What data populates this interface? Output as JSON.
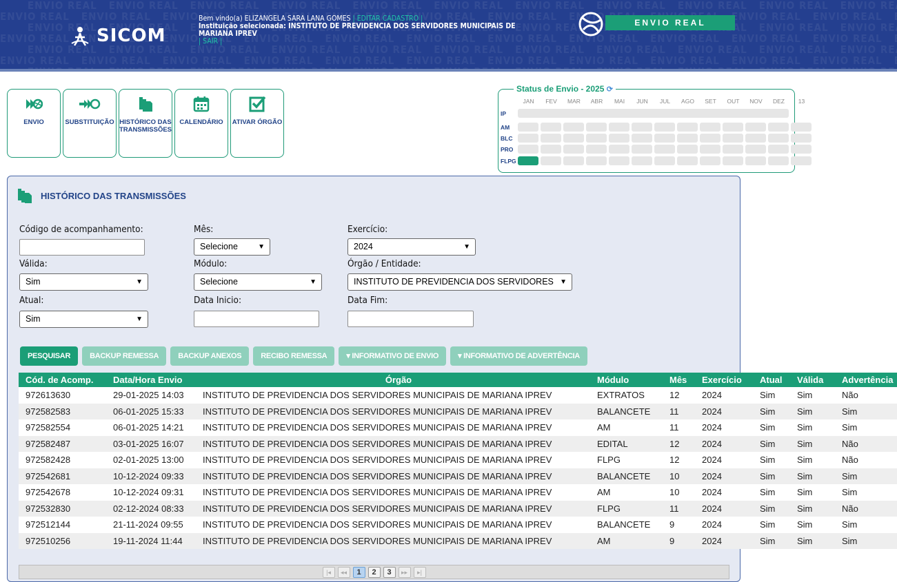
{
  "header": {
    "logo_text": "SICOM",
    "welcome_prefix": "Bem vindo(a) ",
    "user_name": "ELIZANGELA SARA LANA GOMES",
    "edit_link": " | EDITAR CADASTRO | ",
    "institution_label": "Instituição selecionada: ",
    "institution_name": "INSTITUTO DE PREVIDENCIA DOS SERVIDORES MUNICIPAIS DE MARIANA IPREV",
    "logout_link": "| SAIR |",
    "mode_badge": "ENVIO REAL",
    "watermark_word": "ENVIO REAL"
  },
  "toolbar": [
    {
      "label": "ENVIO",
      "icon": "envio-icon"
    },
    {
      "label": "SUBSTITUIÇÃO",
      "icon": "substituicao-icon"
    },
    {
      "label": "HISTÓRICO DAS TRANSMISSÕES",
      "icon": "historico-icon"
    },
    {
      "label": "CALENDÁRIO",
      "icon": "calendar-icon"
    },
    {
      "label": "ATIVAR ÓRGÃO",
      "icon": "checkbox-icon"
    }
  ],
  "status_envio": {
    "title": "Status de Envio - 2025",
    "months": [
      "JAN",
      "FEV",
      "MAR",
      "ABR",
      "MAI",
      "JUN",
      "JUL",
      "AGO",
      "SET",
      "OUT",
      "NOV",
      "DEZ",
      "13"
    ],
    "rows": [
      "IP",
      "AM",
      "BLC",
      "PRO",
      "FLPG"
    ],
    "sent": {
      "FLPG": [
        "JAN"
      ]
    }
  },
  "panel": {
    "title": "HISTÓRICO DAS TRANSMISSÕES",
    "filters": {
      "codigo_label": "Código de acompanhamento:",
      "codigo_value": "",
      "mes_label": "Mês:",
      "mes_value": "Selecione",
      "exercicio_label": "Exercício:",
      "exercicio_value": "2024",
      "valida_label": "Válida:",
      "valida_value": "Sim",
      "modulo_label": "Módulo:",
      "modulo_value": "Selecione",
      "orgao_label": "Órgão / Entidade:",
      "orgao_value": "INSTITUTO DE PREVIDENCIA DOS SERVIDORES",
      "atual_label": "Atual:",
      "atual_value": "Sim",
      "data_inicio_label": "Data Inicio:",
      "data_inicio_value": "",
      "data_fim_label": "Data Fim:",
      "data_fim_value": ""
    },
    "actions": {
      "pesquisar": "PESQUISAR",
      "backup_remessa": "BACKUP REMESSA",
      "backup_anexos": "BACKUP ANEXOS",
      "recibo_remessa": "RECIBO REMESSA",
      "informativo_envio": "INFORMATIVO DE ENVIO",
      "informativo_advertencia": "INFORMATIVO DE ADVERTÊNCIA"
    }
  },
  "table": {
    "columns": [
      "Cód. de Acomp.",
      "Data/Hora Envio",
      "Órgão",
      "Módulo",
      "Mês",
      "Exercício",
      "Atual",
      "Válida",
      "Advertência"
    ],
    "rows": [
      [
        "972613630",
        "29-01-2025 14:03",
        "INSTITUTO DE PREVIDENCIA DOS SERVIDORES MUNICIPAIS DE MARIANA IPREV",
        "EXTRATOS",
        "12",
        "2024",
        "Sim",
        "Sim",
        "Não"
      ],
      [
        "972582583",
        "06-01-2025 15:33",
        "INSTITUTO DE PREVIDENCIA DOS SERVIDORES MUNICIPAIS DE MARIANA IPREV",
        "BALANCETE",
        "11",
        "2024",
        "Sim",
        "Sim",
        "Sim"
      ],
      [
        "972582554",
        "06-01-2025 14:21",
        "INSTITUTO DE PREVIDENCIA DOS SERVIDORES MUNICIPAIS DE MARIANA IPREV",
        "AM",
        "11",
        "2024",
        "Sim",
        "Sim",
        "Sim"
      ],
      [
        "972582487",
        "03-01-2025 16:07",
        "INSTITUTO DE PREVIDENCIA DOS SERVIDORES MUNICIPAIS DE MARIANA IPREV",
        "EDITAL",
        "12",
        "2024",
        "Sim",
        "Sim",
        "Não"
      ],
      [
        "972582428",
        "02-01-2025 13:00",
        "INSTITUTO DE PREVIDENCIA DOS SERVIDORES MUNICIPAIS DE MARIANA IPREV",
        "FLPG",
        "12",
        "2024",
        "Sim",
        "Sim",
        "Não"
      ],
      [
        "972542681",
        "10-12-2024 09:33",
        "INSTITUTO DE PREVIDENCIA DOS SERVIDORES MUNICIPAIS DE MARIANA IPREV",
        "BALANCETE",
        "10",
        "2024",
        "Sim",
        "Sim",
        "Sim"
      ],
      [
        "972542678",
        "10-12-2024 09:31",
        "INSTITUTO DE PREVIDENCIA DOS SERVIDORES MUNICIPAIS DE MARIANA IPREV",
        "AM",
        "10",
        "2024",
        "Sim",
        "Sim",
        "Sim"
      ],
      [
        "972532830",
        "02-12-2024 08:33",
        "INSTITUTO DE PREVIDENCIA DOS SERVIDORES MUNICIPAIS DE MARIANA IPREV",
        "FLPG",
        "11",
        "2024",
        "Sim",
        "Sim",
        "Não"
      ],
      [
        "972512144",
        "21-11-2024 09:55",
        "INSTITUTO DE PREVIDENCIA DOS SERVIDORES MUNICIPAIS DE MARIANA IPREV",
        "BALANCETE",
        "9",
        "2024",
        "Sim",
        "Sim",
        "Sim"
      ],
      [
        "972510256",
        "19-11-2024 11:44",
        "INSTITUTO DE PREVIDENCIA DOS SERVIDORES MUNICIPAIS DE MARIANA IPREV",
        "AM",
        "9",
        "2024",
        "Sim",
        "Sim",
        "Sim"
      ]
    ]
  },
  "pagination": {
    "first": "|◂",
    "prev": "◂◂",
    "pages": [
      "1",
      "2",
      "3"
    ],
    "current": "1",
    "next": "▸▸",
    "last": "▸|"
  },
  "colors": {
    "header_bg": "#243f8f",
    "accent_green": "#1b9e77",
    "link_teal": "#1fc4a6",
    "label_blue": "#224488",
    "panel_bg": "#e5e9f3"
  }
}
